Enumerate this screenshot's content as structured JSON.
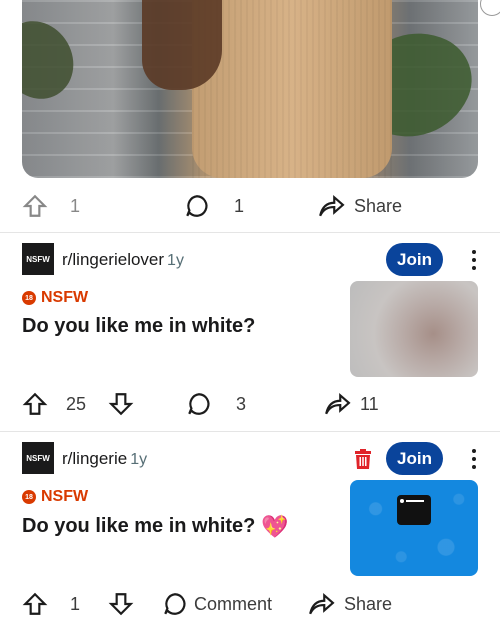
{
  "top_card": {
    "upvotes": "1",
    "comments": "1",
    "share_label": "Share"
  },
  "posts": [
    {
      "avatar_label": "NSFW",
      "subreddit": "r/lingerielover",
      "age": "1y",
      "join_label": "Join",
      "nsfw_badge": "18",
      "nsfw_label": "NSFW",
      "title": "Do you like me in white?",
      "upvotes": "25",
      "comments": "3",
      "shares": "11"
    },
    {
      "avatar_label": "NSFW",
      "subreddit": "r/lingerie",
      "age": "1y",
      "join_label": "Join",
      "nsfw_badge": "18",
      "nsfw_label": "NSFW",
      "title": "Do you like me in white?",
      "title_emoji": "💖",
      "upvotes": "1",
      "comment_label": "Comment",
      "share_label": "Share"
    }
  ],
  "colors": {
    "join_button": "#0a449b",
    "nsfw": "#d93a00",
    "delete_icon": "#e0242a"
  }
}
